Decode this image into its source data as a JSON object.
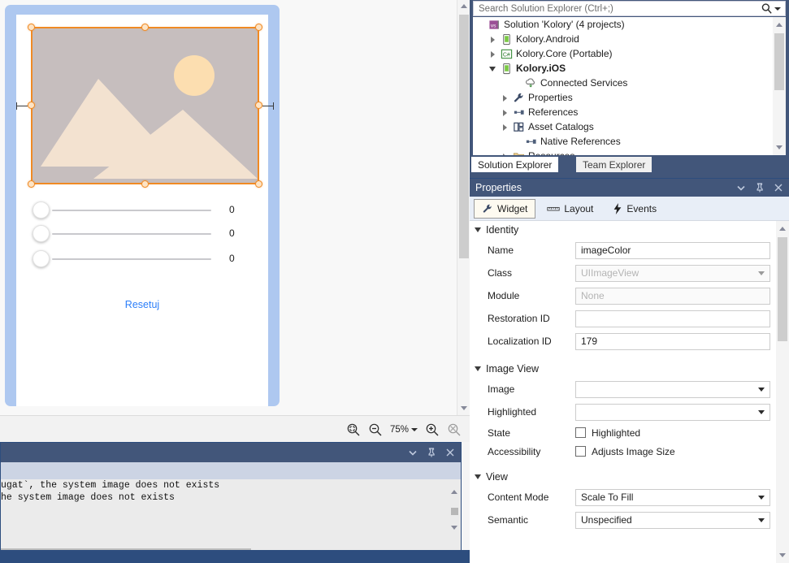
{
  "designer": {
    "device": {
      "image_view": {
        "name": "image-view-placeholder",
        "selected": true
      },
      "sliders": [
        {
          "value": "0"
        },
        {
          "value": "0"
        },
        {
          "value": "0"
        }
      ],
      "reset_link": "Resetuj"
    },
    "toolbar": {
      "zoom_level": "75%",
      "icons": {
        "fit_to_window": "zoom-fit-icon",
        "zoom_out": "zoom-out-icon",
        "zoom_in": "zoom-in-icon",
        "actual_size": "zoom-actual-size-icon"
      }
    }
  },
  "output_panel": {
    "lines": [
      "ugat`, the system image does not exists",
      "he system image does not exists"
    ],
    "title_buttons": [
      "window-dropdown-icon",
      "pin-icon",
      "close-icon"
    ]
  },
  "solution_explorer": {
    "search": {
      "placeholder": "Search Solution Explorer (Ctrl+;)",
      "value": ""
    },
    "tree": [
      {
        "label": "Solution 'Kolory' (4 projects)",
        "indent": 0,
        "expander": "none",
        "icon": "solution-icon",
        "bold": false
      },
      {
        "label": "Kolory.Android",
        "indent": 1,
        "expander": "closed",
        "icon": "android-project-icon",
        "bold": false
      },
      {
        "label": "Kolory.Core (Portable)",
        "indent": 1,
        "expander": "closed",
        "icon": "csharp-project-icon",
        "bold": false
      },
      {
        "label": "Kolory.iOS",
        "indent": 1,
        "expander": "open",
        "icon": "ios-project-icon",
        "bold": true
      },
      {
        "label": "Connected Services",
        "indent": 3,
        "expander": "none",
        "icon": "connected-services-icon",
        "bold": false
      },
      {
        "label": "Properties",
        "indent": 2,
        "expander": "closed",
        "icon": "properties-wrench-icon",
        "bold": false
      },
      {
        "label": "References",
        "indent": 2,
        "expander": "closed",
        "icon": "references-icon",
        "bold": false
      },
      {
        "label": "Asset Catalogs",
        "indent": 2,
        "expander": "closed",
        "icon": "asset-catalogs-icon",
        "bold": false
      },
      {
        "label": "Native References",
        "indent": 3,
        "expander": "none",
        "icon": "references-icon",
        "bold": false
      },
      {
        "label": "Resources",
        "indent": 2,
        "expander": "closed",
        "icon": "folder-icon",
        "bold": false
      }
    ],
    "tabs": {
      "solution_explorer": "Solution Explorer",
      "team_explorer": "Team Explorer"
    }
  },
  "properties": {
    "title": "Properties",
    "title_buttons": [
      "window-dropdown-icon",
      "pin-icon",
      "close-icon"
    ],
    "tabs": [
      {
        "label": "Widget",
        "icon": "wrench-icon",
        "active": true
      },
      {
        "label": "Layout",
        "icon": "ruler-icon",
        "active": false
      },
      {
        "label": "Events",
        "icon": "lightning-icon",
        "active": false
      }
    ],
    "groups": [
      {
        "title": "Identity",
        "rows": [
          {
            "label": "Name",
            "value": "imageColor",
            "type": "text",
            "disabled": false,
            "placeholder": ""
          },
          {
            "label": "Class",
            "value": "",
            "type": "combo",
            "disabled": true,
            "placeholder": "UIImageView"
          },
          {
            "label": "Module",
            "value": "",
            "type": "text",
            "disabled": true,
            "placeholder": "None"
          },
          {
            "label": "Restoration ID",
            "value": "",
            "type": "text",
            "disabled": false,
            "placeholder": ""
          },
          {
            "label": "Localization ID",
            "value": "179",
            "type": "text",
            "disabled": false,
            "placeholder": ""
          }
        ]
      },
      {
        "title": "Image View",
        "rows": [
          {
            "label": "Image",
            "value": "",
            "type": "combo",
            "disabled": false,
            "placeholder": ""
          },
          {
            "label": "Highlighted",
            "value": "",
            "type": "combo",
            "disabled": false,
            "placeholder": ""
          },
          {
            "label": "State",
            "value": "Highlighted",
            "type": "checkbox",
            "checked": false
          },
          {
            "label": "Accessibility",
            "value": "Adjusts Image Size",
            "type": "checkbox",
            "checked": false
          }
        ]
      },
      {
        "title": "View",
        "rows": [
          {
            "label": "Content Mode",
            "value": "Scale To Fill",
            "type": "combo",
            "disabled": false,
            "placeholder": ""
          },
          {
            "label": "Semantic",
            "value": "Unspecified",
            "type": "combo",
            "disabled": false,
            "placeholder": ""
          }
        ]
      }
    ]
  },
  "colors": {
    "chrome": "#42567a",
    "accent_selection": "#f08a24",
    "link": "#2d7ff9",
    "device_frame": "#aec8f0"
  }
}
